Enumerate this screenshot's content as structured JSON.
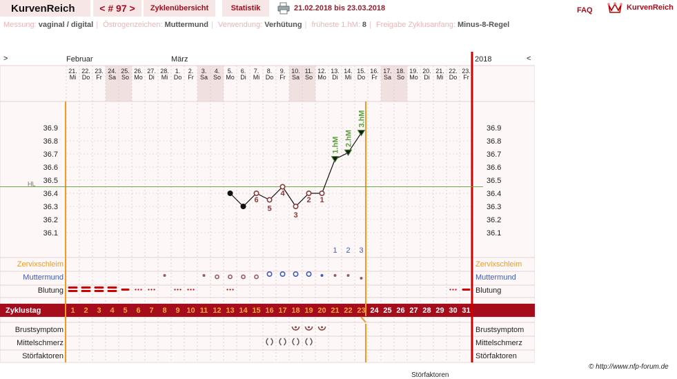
{
  "header": {
    "logo": "KurvenReich",
    "cycle_nav": "< # 97 >",
    "tabs": [
      "Zyklenübersicht",
      "Statistik"
    ],
    "date_range": "21.02.2018 bis 23.03.2018",
    "faq": "FAQ",
    "brand": "KurvenReich"
  },
  "info": [
    {
      "label": "Messung:",
      "value": "vaginal / digital"
    },
    {
      "label": "Östrogenzeichen:",
      "value": "Muttermund"
    },
    {
      "label": "Verwendung:",
      "value": "Verhütung"
    },
    {
      "label": "früheste 1.hM:",
      "value": "8"
    },
    {
      "label": "Freigabe Zyklusanfang:",
      "value": "Minus-8-Regel"
    }
  ],
  "chart_nav": {
    "prev": ">",
    "next": "<",
    "year": "2018"
  },
  "months": [
    {
      "label": "Februar",
      "day_index": 0
    },
    {
      "label": "März",
      "day_index": 8
    }
  ],
  "dates": [
    "21.",
    "22.",
    "23.",
    "24.",
    "25.",
    "26.",
    "27.",
    "28.",
    "1.",
    "2.",
    "3.",
    "4.",
    "5.",
    "6.",
    "7.",
    "8.",
    "9.",
    "10.",
    "11.",
    "12.",
    "13.",
    "14.",
    "15.",
    "16.",
    "17.",
    "18.",
    "19.",
    "20.",
    "21.",
    "22.",
    "23."
  ],
  "weekdays": [
    "Mi",
    "Do",
    "Fr",
    "Sa",
    "So",
    "Mo",
    "Di",
    "Mi",
    "Do",
    "Fr",
    "Sa",
    "So",
    "Mo",
    "Di",
    "Mi",
    "Do",
    "Fr",
    "Sa",
    "So",
    "Mo",
    "Di",
    "Mi",
    "Do",
    "Fr",
    "Sa",
    "So",
    "Mo",
    "Di",
    "Mi",
    "Do",
    "Fr"
  ],
  "weekend_days": [
    3,
    4,
    10,
    11,
    17,
    18,
    24,
    25
  ],
  "cycle_days": [
    "1",
    "2",
    "3",
    "4",
    "5",
    "6",
    "7",
    "8",
    "9",
    "10",
    "11",
    "12",
    "13",
    "14",
    "15",
    "16",
    "17",
    "18",
    "19",
    "20",
    "21",
    "22",
    "23",
    "24",
    "25",
    "26",
    "27",
    "28",
    "29",
    "30",
    "31"
  ],
  "row_labels": {
    "cervix": "Zervixschleim",
    "mm": "Muttermund",
    "bleed": "Blutung",
    "cycleday": "Zyklustag",
    "breast": "Brustsymptom",
    "pain": "Mittelschmerz",
    "disturb": "Störfaktoren"
  },
  "hl_label": "HL",
  "chart_data": {
    "type": "line",
    "y_ticks": [
      "36.9",
      "36.8",
      "36.7",
      "36.6",
      "36.5",
      "36.4",
      "36.3",
      "36.2",
      "36.1"
    ],
    "ylim": [
      36.05,
      36.95
    ],
    "coverline": 36.45,
    "temperatures": [
      {
        "day": 13,
        "temp": 36.4,
        "label": ""
      },
      {
        "day": 14,
        "temp": 36.3,
        "label": ""
      },
      {
        "day": 15,
        "temp": 36.4,
        "label": "6"
      },
      {
        "day": 16,
        "temp": 36.35,
        "label": "5"
      },
      {
        "day": 17,
        "temp": 36.45,
        "label": "4"
      },
      {
        "day": 18,
        "temp": 36.3,
        "label": "3"
      },
      {
        "day": 19,
        "temp": 36.4,
        "label": "2"
      },
      {
        "day": 20,
        "temp": 36.4,
        "label": "1"
      },
      {
        "day": 21,
        "temp": 36.66,
        "label": "1.hM",
        "high": true
      },
      {
        "day": 22,
        "temp": 36.71,
        "label": "2.hM",
        "high": true
      },
      {
        "day": 23,
        "temp": 36.86,
        "label": "3.hM",
        "high": true
      }
    ],
    "count_numbers": [
      {
        "day": 21,
        "value": "1"
      },
      {
        "day": 22,
        "value": "2"
      },
      {
        "day": 23,
        "value": "3"
      }
    ]
  },
  "bleeding": [
    {
      "day": 1,
      "level": "heavy"
    },
    {
      "day": 2,
      "level": "heavy"
    },
    {
      "day": 3,
      "level": "heavy"
    },
    {
      "day": 4,
      "level": "heavy"
    },
    {
      "day": 5,
      "level": "medium"
    },
    {
      "day": 6,
      "level": "spot"
    },
    {
      "day": 7,
      "level": "spot"
    },
    {
      "day": 9,
      "level": "spot"
    },
    {
      "day": 10,
      "level": "spot"
    },
    {
      "day": 13,
      "level": "spot"
    },
    {
      "day": 30,
      "level": "spot"
    },
    {
      "day": 31,
      "level": "medium"
    }
  ],
  "cervix_position": [
    {
      "day": 8,
      "type": "dot"
    },
    {
      "day": 11,
      "type": "dot"
    },
    {
      "day": 12,
      "type": "o-low"
    },
    {
      "day": 13,
      "type": "o-low"
    },
    {
      "day": 14,
      "type": "o-low"
    },
    {
      "day": 15,
      "type": "o-low"
    },
    {
      "day": 16,
      "type": "o-high"
    },
    {
      "day": 17,
      "type": "o-high"
    },
    {
      "day": 18,
      "type": "o-high"
    },
    {
      "day": 19,
      "type": "o-high"
    },
    {
      "day": 20,
      "type": "dot-blue"
    },
    {
      "day": 21,
      "type": "dot"
    },
    {
      "day": 22,
      "type": "dot"
    },
    {
      "day": 23,
      "type": "dot-low"
    }
  ],
  "breast_days": [
    18,
    19,
    20
  ],
  "pain_days": [
    16,
    17,
    18,
    19
  ],
  "footer": {
    "copyright": "© http://www.nfp-forum.de",
    "stoer": "Störfaktoren"
  }
}
